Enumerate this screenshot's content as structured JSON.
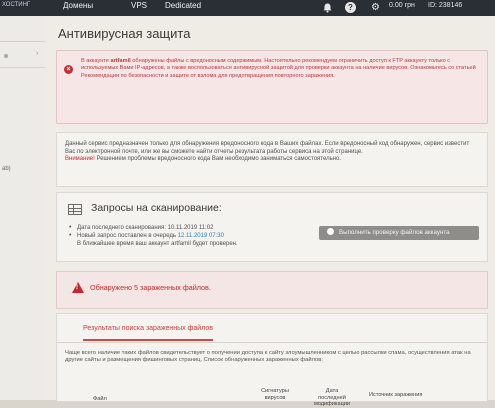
{
  "topnav": {
    "items": [
      "ХОСТИНГ",
      "Домены",
      "VPS",
      "Dedicated"
    ],
    "balance": "0.00 грн",
    "account_id": "ID: 238146",
    "icons": [
      "bell-icon",
      "help-icon",
      "gear-icon"
    ]
  },
  "sidebar": {
    "fragment": "ab)"
  },
  "page": {
    "title": "Антивирусная защита"
  },
  "alert": {
    "prefix": "В аккаунте ",
    "account": "artfamil",
    "text": " обнаружены файлы с вредоносным содержимым. Настоятельно рекомендуем ограничить доступ к FTP аккаунту только с используемых Вами IP-адресов, а также воспользоваться антивирусной защитой для проверки аккаунта на наличие вирусов. Ознакомьтесь со статьей Рекомендации по безопасности и защите от взлома для предотвращения повторного заражения."
  },
  "info": {
    "text": "Данный сервис предназначен только для обнаружения вредоносного кода в Ваших файлах. Если вредоносный код обнаружен, сервис известит Вас по электронной почте, или же вы сможете найти отчеты результата работы сервиса на этой странице.",
    "warn_label": "Внимание!",
    "warn_text": " Решением проблемы вредоносного кода Вам необходимо заниматься самостоятельно."
  },
  "scan": {
    "title": "Запросы на сканирование:",
    "last_scan_label": "Дата последнего сканирования: ",
    "last_scan_value": "10.11.2019 11:02",
    "queued_label": "Новый запрос поставлен в очередь ",
    "queued_value": "12.11.2019 07:30",
    "queued_note": "В ближайшее время ваш аккаунт artfamil будет проверен.",
    "button_label": "Выполнить проверку файлов аккаунта"
  },
  "infected": {
    "text": "Обнаружено 5 зараженных файлов."
  },
  "results": {
    "tab_label": "Результаты поиска зараженных файлов",
    "description": "Чаще всего наличие таких файлов свидетельствует о получении доступа к сайту злоумышленником с целью рассылки спама, осуществления атак на другие сайты и размещения фишинговых страниц. Список обнаруженных зараженных файлов:",
    "columns": [
      "Файл",
      "Сигнатуры вирусов",
      "Дата последней модификации",
      "Источник заражения"
    ]
  }
}
